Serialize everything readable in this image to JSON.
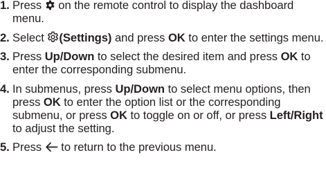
{
  "steps": [
    {
      "num": "1.",
      "t1": "Press ",
      "icon": "gear-icon",
      "t2": " on the remote control to display the dashboard menu."
    },
    {
      "num": "2.",
      "t1": "Select ",
      "icon": "settings-gear-icon",
      "b1": "(Settings)",
      "t2": " and press ",
      "b2": "OK",
      "t3": " to enter the settings menu."
    },
    {
      "num": "3.",
      "t1": "Press ",
      "b1": "Up/Down",
      "t2": " to select the desired item and press ",
      "b2": "OK",
      "t3": " to enter the corresponding submenu."
    },
    {
      "num": "4.",
      "t1": "In submenus, press ",
      "b1": "Up/Down",
      "t2": " to select menu options, then press ",
      "b2": "OK",
      "t3": " to enter the option list or the corresponding submenu, or press ",
      "b3": "OK",
      "t4": " to toggle on or off, or press ",
      "b4": "Left/Right",
      "t5": " to adjust the setting."
    },
    {
      "num": "5.",
      "t1": "Press ",
      "icon": "back-arrow-icon",
      "t2": " to return to the previous menu."
    }
  ]
}
